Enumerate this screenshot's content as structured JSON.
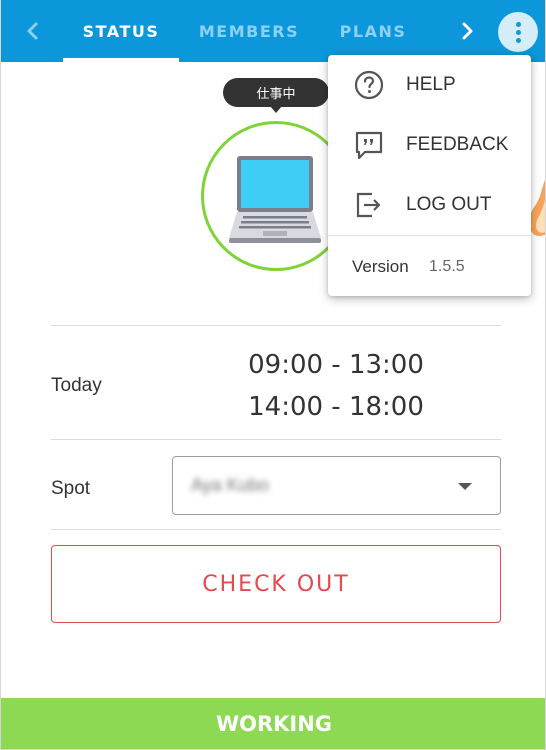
{
  "nav": {
    "tabs": [
      {
        "label": "STATUS",
        "active": true
      },
      {
        "label": "MEMBERS",
        "active": false
      },
      {
        "label": "PLANS",
        "active": false
      }
    ],
    "accent_color": "#0b97d9"
  },
  "status": {
    "badge": "仕事中",
    "icon": "laptop-icon",
    "ring_color": "#7ed338"
  },
  "today": {
    "label": "Today",
    "slots": [
      "09:00 - 13:00",
      "14:00 - 18:00"
    ]
  },
  "spot": {
    "label": "Spot",
    "value": "Aya Kubo"
  },
  "actions": {
    "checkout_label": "CHECK OUT",
    "checkout_color": "#e5484d"
  },
  "footer": {
    "state": "WORKING",
    "color": "#8ed953"
  },
  "menu": {
    "items": [
      {
        "label": "HELP",
        "icon": "help-icon"
      },
      {
        "label": "FEEDBACK",
        "icon": "feedback-icon"
      },
      {
        "label": "LOG OUT",
        "icon": "logout-icon"
      }
    ],
    "version_label": "Version",
    "version_number": "1.5.5"
  }
}
